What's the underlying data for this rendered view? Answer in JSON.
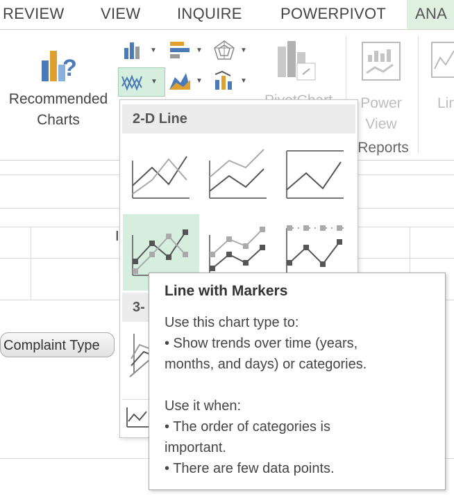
{
  "tabs": [
    "REVIEW",
    "VIEW",
    "INQUIRE",
    "POWERPIVOT",
    "ANA"
  ],
  "ribbon": {
    "recommended_charts_line1": "Recommended",
    "recommended_charts_line2": "Charts",
    "pivotchart_label": "PivotChart",
    "power_view_line1": "Power",
    "power_view_line2": "View",
    "reports_group_label": "Reports",
    "line_partial_label": "Lin"
  },
  "gallery": {
    "section_2d": "2-D Line",
    "section_3d": "3-",
    "items_2d_row1": [
      "Line",
      "Stacked Line",
      "100% Stacked Line"
    ],
    "items_2d_row2": [
      "Line with Markers",
      "Stacked Line with Markers",
      "100% Stacked Line with Markers"
    ]
  },
  "sheet": {
    "field_pill": "Complaint Type",
    "cell_partial": "I"
  },
  "tooltip": {
    "title": "Line with Markers",
    "line1": "Use this chart type to:",
    "line2": "• Show trends over time (years,",
    "line3": "months, and days) or categories.",
    "line4": "Use it when:",
    "line5": "• The order of categories is",
    "line6": "important.",
    "line7": "• There are few data points."
  },
  "colors": {
    "accent_green": "#dff0e0",
    "selected_thumb": "#d5eedd",
    "chart_blue": "#4a7ab8",
    "chart_orange": "#e0a030"
  }
}
